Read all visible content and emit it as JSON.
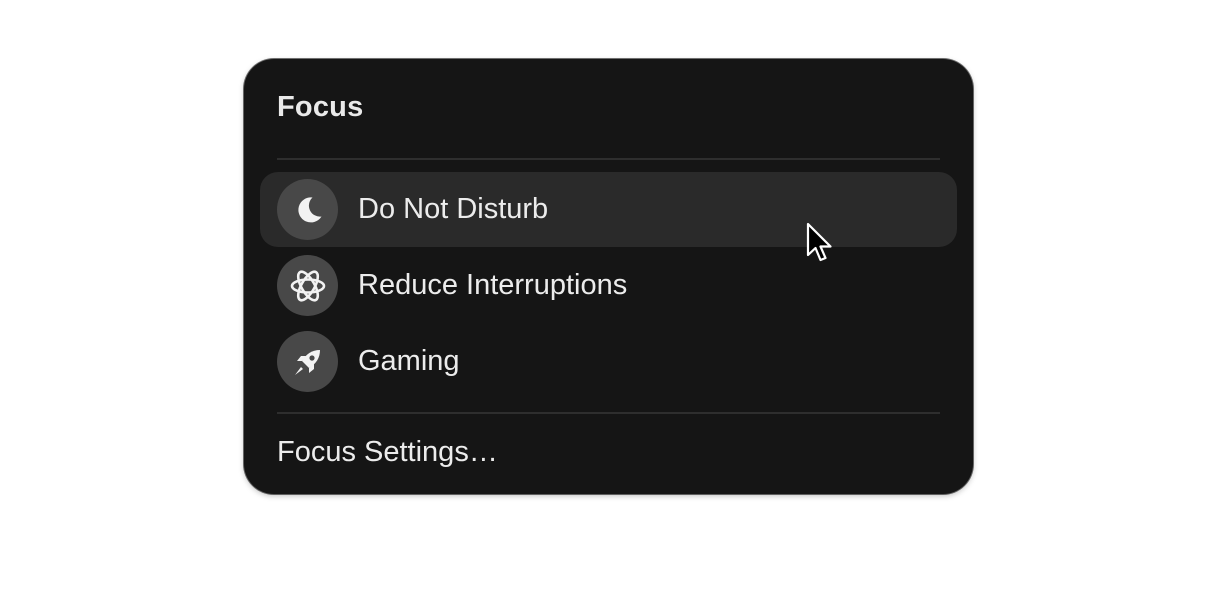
{
  "menu": {
    "title": "Focus",
    "items": [
      {
        "label": "Do Not Disturb",
        "icon": "moon-icon",
        "highlighted": true
      },
      {
        "label": "Reduce Interruptions",
        "icon": "atom-icon",
        "highlighted": false
      },
      {
        "label": "Gaming",
        "icon": "rocket-icon",
        "highlighted": false
      }
    ],
    "settings_label": "Focus Settings…"
  },
  "colors": {
    "panel_background": "#151515",
    "highlight_background": "#2a2a2a",
    "icon_circle": "#484848",
    "text": "#ececec"
  }
}
